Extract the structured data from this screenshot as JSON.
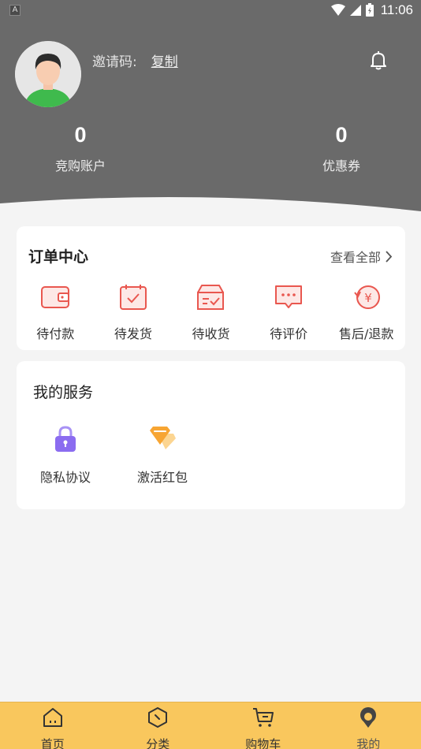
{
  "status_bar": {
    "time": "11:06",
    "notification_icon": "A"
  },
  "profile": {
    "invite_label": "邀请码:",
    "copy_label": "复制"
  },
  "stats": [
    {
      "value": "0",
      "label": "竞购账户"
    },
    {
      "value": "0",
      "label": "优惠券"
    }
  ],
  "orders": {
    "title": "订单中心",
    "view_all": "查看全部",
    "items": [
      {
        "label": "待付款",
        "icon": "wallet-icon"
      },
      {
        "label": "待发货",
        "icon": "calendar-check-icon"
      },
      {
        "label": "待收货",
        "icon": "box-icon"
      },
      {
        "label": "待评价",
        "icon": "comment-icon"
      },
      {
        "label": "售后/退款",
        "icon": "refund-icon"
      }
    ]
  },
  "services": {
    "title": "我的服务",
    "items": [
      {
        "label": "隐私协议",
        "icon": "lock-icon"
      },
      {
        "label": "激活红包",
        "icon": "gem-icon"
      }
    ]
  },
  "tabbar": {
    "items": [
      {
        "label": "首页",
        "icon": "home-icon"
      },
      {
        "label": "分类",
        "icon": "category-icon"
      },
      {
        "label": "购物车",
        "icon": "cart-icon"
      },
      {
        "label": "我的",
        "icon": "profile-icon"
      }
    ],
    "active": "我的"
  },
  "colors": {
    "header_bg": "#6a6a6a",
    "accent_red": "#e9574f",
    "tabbar_bg": "#f9c75d",
    "lock_purple": "#8b6cf0",
    "gem_orange": "#f7a533"
  }
}
